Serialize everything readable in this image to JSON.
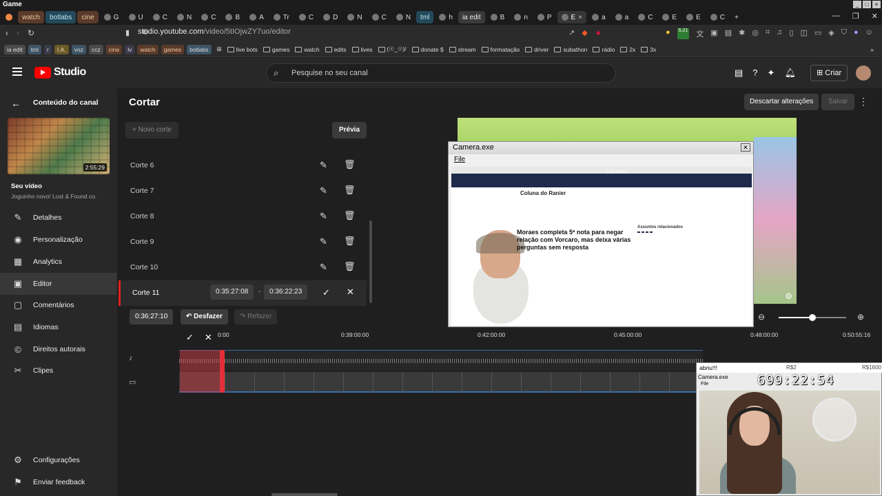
{
  "os": {
    "title": "Game"
  },
  "browser": {
    "tabs": [
      {
        "label": "watch",
        "style": "named"
      },
      {
        "label": "botlabs",
        "style": "named b"
      },
      {
        "label": "cine",
        "style": "named"
      },
      {
        "label": "G",
        "style": ""
      },
      {
        "label": "U",
        "style": ""
      },
      {
        "label": "C",
        "style": ""
      },
      {
        "label": "N",
        "style": ""
      },
      {
        "label": "C",
        "style": ""
      },
      {
        "label": "B",
        "style": ""
      },
      {
        "label": "A",
        "style": ""
      },
      {
        "label": "Tr",
        "style": ""
      },
      {
        "label": "C",
        "style": ""
      },
      {
        "label": "D",
        "style": ""
      },
      {
        "label": "N",
        "style": ""
      },
      {
        "label": "C",
        "style": ""
      },
      {
        "label": "N",
        "style": ""
      },
      {
        "label": "tml",
        "style": "named b"
      },
      {
        "label": "h",
        "style": ""
      },
      {
        "label": "ia edit",
        "style": "named c"
      },
      {
        "label": "B",
        "style": ""
      },
      {
        "label": "n",
        "style": ""
      },
      {
        "label": "P",
        "style": ""
      },
      {
        "label": "E",
        "style": "active"
      },
      {
        "label": "a",
        "style": ""
      },
      {
        "label": "a",
        "style": ""
      },
      {
        "label": "C",
        "style": ""
      },
      {
        "label": "E",
        "style": ""
      },
      {
        "label": "E",
        "style": ""
      },
      {
        "label": "C",
        "style": ""
      }
    ],
    "url_host": "studio.youtube.com",
    "url_path": "/video/5tIOjwZY7uo/editor",
    "ext_badge": "5,21",
    "bookmark_chips": [
      {
        "label": "ia edit",
        "cls": "c1"
      },
      {
        "label": "tml",
        "cls": "c2"
      },
      {
        "label": "r",
        "cls": "c5"
      },
      {
        "label": "I.A.",
        "cls": "c3"
      },
      {
        "label": "voz",
        "cls": "c2"
      },
      {
        "label": "ccz",
        "cls": "c1"
      },
      {
        "label": "cine",
        "cls": "c4"
      },
      {
        "label": "lv",
        "cls": "c5"
      },
      {
        "label": "watch",
        "cls": "c4"
      },
      {
        "label": "games",
        "cls": "c4"
      },
      {
        "label": "botlabs",
        "cls": "c2"
      }
    ],
    "bookmark_items": [
      "live bots",
      "games",
      "watch",
      "edits",
      "lives",
      "(☉_☉)/",
      "donate $",
      "stream",
      "formatação",
      "driver",
      "subathon",
      "rádio",
      "2x",
      "3x"
    ]
  },
  "header": {
    "logo_text": "Studio",
    "search_placeholder": "Pesquise no seu canal",
    "create_label": "Criar"
  },
  "sidebar": {
    "back_label": "Conteúdo do canal",
    "thumb_duration": "2:55:29",
    "your_video": "Seu vídeo",
    "video_title": "Joguinho novo! Lost & Found co.",
    "items": [
      {
        "label": "Detalhes",
        "icon": "pencil-icon",
        "glyph": "✎"
      },
      {
        "label": "Personalização",
        "icon": "personalization-icon",
        "glyph": "◉"
      },
      {
        "label": "Analytics",
        "icon": "analytics-icon",
        "glyph": "▦"
      },
      {
        "label": "Editor",
        "icon": "editor-icon",
        "glyph": "▣",
        "active": true
      },
      {
        "label": "Comentários",
        "icon": "comments-icon",
        "glyph": "▢"
      },
      {
        "label": "Idiomas",
        "icon": "languages-icon",
        "glyph": "▤"
      },
      {
        "label": "Direitos autorais",
        "icon": "copyright-icon",
        "glyph": "©"
      },
      {
        "label": "Clipes",
        "icon": "scissors-icon",
        "glyph": "✂"
      }
    ],
    "settings_label": "Configurações",
    "feedback_label": "Enviar feedback"
  },
  "editor": {
    "title": "Cortar",
    "discard_label": "Descartar alterações",
    "save_label": "Salvar",
    "new_cut_label": "Novo corte",
    "preview_label": "Prévia",
    "cuts": [
      "Corte 6",
      "Corte 7",
      "Corte 8",
      "Corte 9",
      "Corte 10"
    ],
    "active_cut": {
      "label": "Corte 11",
      "start": "0:35:27:08",
      "end": "0:36:22:23",
      "separator": "-"
    },
    "current_time": "0:36:27:10",
    "undo_label": "Desfazer",
    "redo_label": "Refazer",
    "zoom_level": 0.5
  },
  "timeline": {
    "ruler": [
      {
        "label": "0:00"
      },
      {
        "label": "0:39:00:00"
      },
      {
        "label": "0:42:00:00"
      },
      {
        "label": "0:45:00:00"
      },
      {
        "label": "0:48:00:00"
      },
      {
        "label": "0:50:55:16"
      }
    ]
  },
  "camera_window": {
    "title": "Camera.exe",
    "menu_file": "File",
    "site_section": "COLUNAS",
    "column_name": "Coluna do Ranier",
    "headline": "Moraes completa 5ª nota para negar relação com Vorcaro, mas deixa várias perguntas sem resposta",
    "related_title": "Assuntos relacionados"
  },
  "overlay_cam": {
    "chat_text": "abriu!!!",
    "r2": "R$2",
    "r1600": "R$1600",
    "title": "Camera.exe",
    "menu": "File",
    "timer": "699:22:54"
  }
}
